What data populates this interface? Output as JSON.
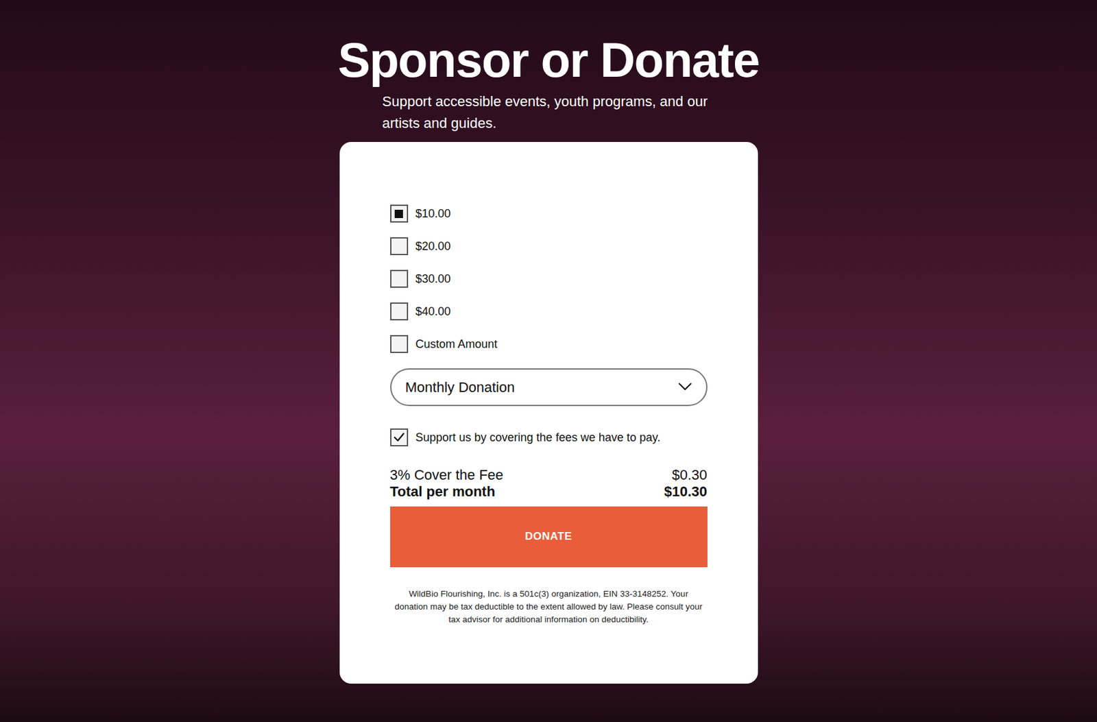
{
  "title": "Sponsor or Donate",
  "subtitle": "Support accessible events, youth programs, and our artists and guides.",
  "amounts": [
    {
      "label": "$10.00",
      "selected": true
    },
    {
      "label": "$20.00",
      "selected": false
    },
    {
      "label": "$30.00",
      "selected": false
    },
    {
      "label": "$40.00",
      "selected": false
    },
    {
      "label": "Custom Amount",
      "selected": false
    }
  ],
  "frequency": {
    "value": "Monthly Donation"
  },
  "cover_fees": {
    "label": "Support us by covering the fees we have to pay.",
    "checked": true
  },
  "fee": {
    "label": "3% Cover the Fee",
    "value": "$0.30"
  },
  "total": {
    "label": "Total per month",
    "value": "$10.30"
  },
  "button": "DONATE",
  "disclaimer": "WildBio Flourishing, Inc. is a 501c(3) organization, EIN 33-3148252. Your donation may be tax deductible to the extent allowed by law. Please consult your tax advisor for additional information on deductibility."
}
